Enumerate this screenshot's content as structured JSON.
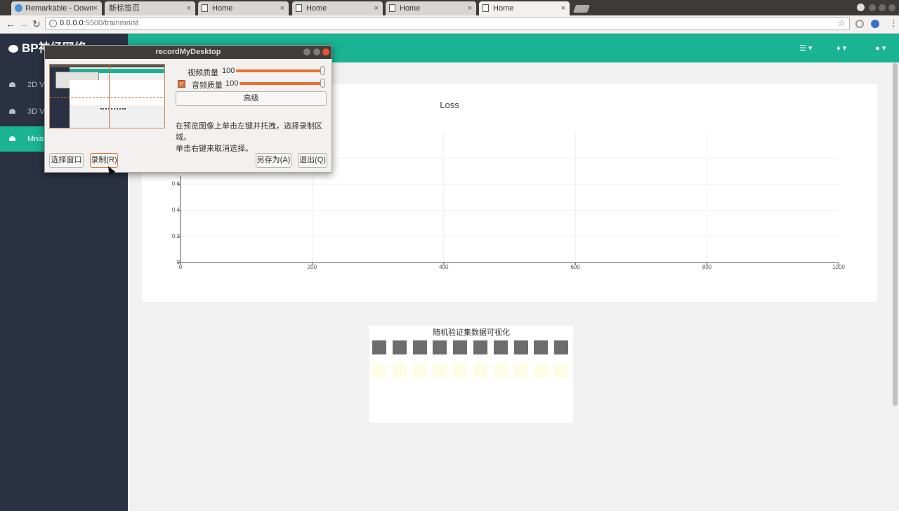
{
  "tabs": [
    {
      "label": "Remarkable - Down",
      "icon": "remarkable-icon"
    },
    {
      "label": "新标签页",
      "icon": "none"
    },
    {
      "label": "Home",
      "icon": "page-icon"
    },
    {
      "label": "Home",
      "icon": "page-icon"
    },
    {
      "label": "Home",
      "icon": "page-icon"
    },
    {
      "label": "Home",
      "icon": "page-icon"
    }
  ],
  "address": {
    "host": "0.0.0.0",
    "path": ":5500/trainmnist"
  },
  "app": {
    "brand": "BP神经网络"
  },
  "sidebar": {
    "items": [
      {
        "label": "2D Vi"
      },
      {
        "label": "3D Vi"
      },
      {
        "label": "Mnist"
      }
    ]
  },
  "recorder": {
    "title": "recordMyDesktop",
    "video_quality_label": "视频质量",
    "video_quality_value": "100",
    "audio_quality_label": "音频质量",
    "audio_quality_value": "100",
    "advanced_label": "高级",
    "hint_line1": "在预览图像上单击左键并托拽，选择录制区域。",
    "hint_line2": "单击右键来取消选择。",
    "select_window_label": "选择窗口",
    "record_label": "录制(R)",
    "save_as_label": "另存为(A)",
    "quit_label": "退出(Q)"
  },
  "mnist": {
    "title": "随机验证集数据可视化",
    "sample_count": 10
  },
  "chart_data": {
    "type": "line",
    "title": "Loss",
    "xlabel": "",
    "ylabel": "",
    "xlim": [
      0,
      1000
    ],
    "ylim": [
      0,
      1
    ],
    "x_ticks": [
      "0",
      "200",
      "400",
      "600",
      "800",
      "1000"
    ],
    "y_ticks": [
      "0",
      "0.2",
      "0.4",
      "0.6"
    ],
    "grid": true,
    "series": []
  },
  "colors": {
    "accent": "#1ab394",
    "sidebar": "#2a3142",
    "recorder_accent": "#e86f30"
  }
}
